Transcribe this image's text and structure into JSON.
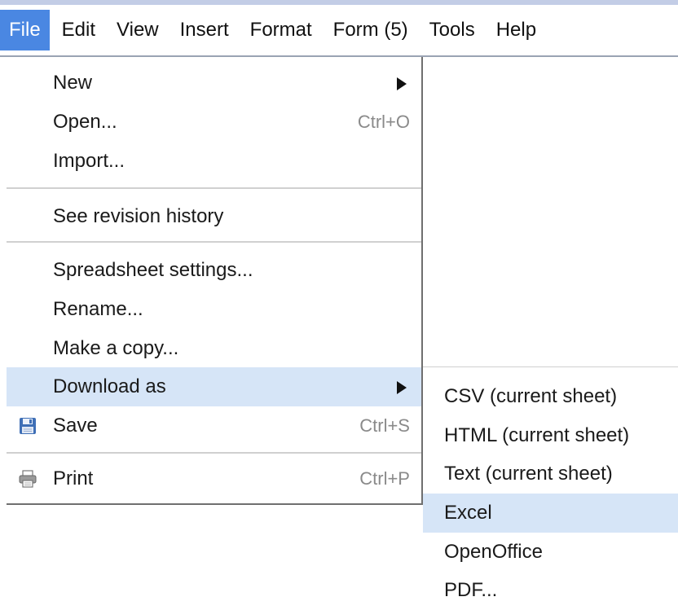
{
  "menubar": {
    "items": [
      {
        "label": "File"
      },
      {
        "label": "Edit"
      },
      {
        "label": "View"
      },
      {
        "label": "Insert"
      },
      {
        "label": "Format"
      },
      {
        "label": "Form (5)"
      },
      {
        "label": "Tools"
      },
      {
        "label": "Help"
      }
    ]
  },
  "file_menu": {
    "new": {
      "label": "New"
    },
    "open": {
      "label": "Open...",
      "shortcut": "Ctrl+O"
    },
    "import": {
      "label": "Import..."
    },
    "revision": {
      "label": "See revision history"
    },
    "settings": {
      "label": "Spreadsheet settings..."
    },
    "rename": {
      "label": "Rename..."
    },
    "copy": {
      "label": "Make a copy..."
    },
    "download": {
      "label": "Download as"
    },
    "save": {
      "label": "Save",
      "shortcut": "Ctrl+S",
      "icon": "floppy-disk-icon"
    },
    "print": {
      "label": "Print",
      "shortcut": "Ctrl+P",
      "icon": "printer-icon"
    }
  },
  "download_submenu": {
    "items": [
      {
        "label": "CSV (current sheet)"
      },
      {
        "label": "HTML (current sheet)"
      },
      {
        "label": "Text (current sheet)"
      },
      {
        "label": "Excel"
      },
      {
        "label": "OpenOffice"
      },
      {
        "label": "PDF..."
      }
    ],
    "highlighted": "Excel"
  },
  "colors": {
    "active_menu": "#4a87e2",
    "highlight": "#d6e5f7",
    "shortcut_text": "#8a8a8a"
  }
}
